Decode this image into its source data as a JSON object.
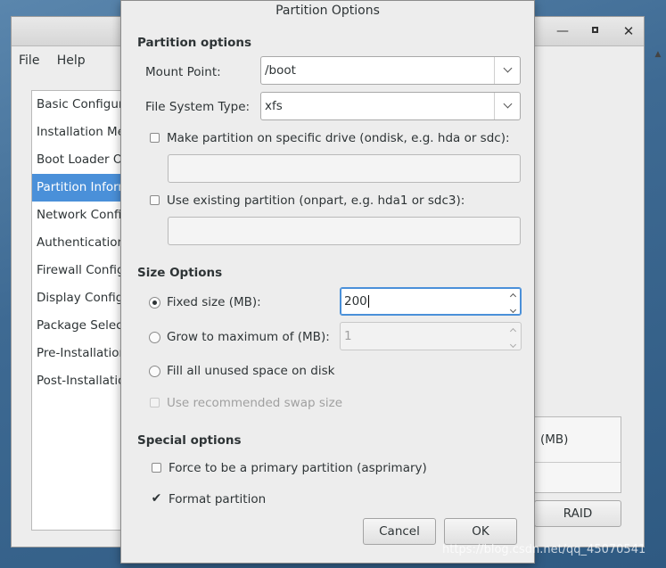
{
  "main_window": {
    "menu": [
      "File",
      "Help"
    ],
    "side_items": [
      "Basic Configuration",
      "Installation Method",
      "Boot Loader Options",
      "Partition Information",
      "Network Configuration",
      "Authentication",
      "Firewall Configuration",
      "Display Configuration",
      "Package Selection",
      "Pre-Installation Script",
      "Post-Installation Script"
    ],
    "selected_index": 3,
    "right_header": "(MB)",
    "raid_button": "RAID"
  },
  "dialog": {
    "title": "Partition Options",
    "partition_section": "Partition options",
    "mount_point_label": "Mount Point:",
    "mount_point_value": "/boot",
    "fs_type_label": "File System Type:",
    "fs_type_value": "xfs",
    "ondisk_label": "Make partition on specific drive (ondisk, e.g. hda or sdc):",
    "ondisk_checked": false,
    "ondisk_value": "",
    "onpart_label": "Use existing partition (onpart, e.g. hda1 or sdc3):",
    "onpart_checked": false,
    "onpart_value": "",
    "size_section": "Size Options",
    "fixed_label": "Fixed size (MB):",
    "fixed_value": "200",
    "grow_label": "Grow to maximum of (MB):",
    "grow_value": "1",
    "fill_label": "Fill all unused space on disk",
    "swap_label": "Use recommended swap size",
    "size_choice": "fixed",
    "special_section": "Special options",
    "primary_label": "Force to be a primary partition (asprimary)",
    "primary_checked": false,
    "format_label": "Format partition",
    "format_checked": true,
    "cancel_label": "Cancel",
    "ok_label": "OK"
  },
  "watermark": "https://blog.csdn.net/qq_45070541"
}
